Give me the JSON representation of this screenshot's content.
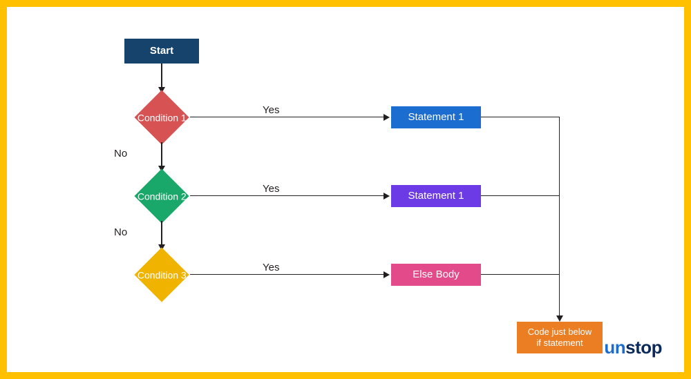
{
  "start": {
    "label": "Start",
    "bg": "#16436b"
  },
  "conditions": [
    {
      "label": "Condition 1",
      "bg": "#d75353",
      "yes": "Yes",
      "no": "No"
    },
    {
      "label": "Condition 2",
      "bg": "#1aa86a",
      "yes": "Yes",
      "no": "No"
    },
    {
      "label": "Condition 3",
      "bg": "#f0b400",
      "yes": "Yes",
      "no": ""
    }
  ],
  "statements": [
    {
      "label": "Statement 1",
      "bg": "#1c6dd0"
    },
    {
      "label": "Statement 1",
      "bg": "#6d3be6"
    },
    {
      "label": "Else Body",
      "bg": "#e34a8a"
    }
  ],
  "final": {
    "label": "Code just below\nif statement",
    "bg": "#eb7d23"
  },
  "logo": {
    "prefix": "un",
    "rest": "stop"
  },
  "colors": {
    "border": "#ffc000",
    "line": "#231f20",
    "text": "#231f20"
  }
}
